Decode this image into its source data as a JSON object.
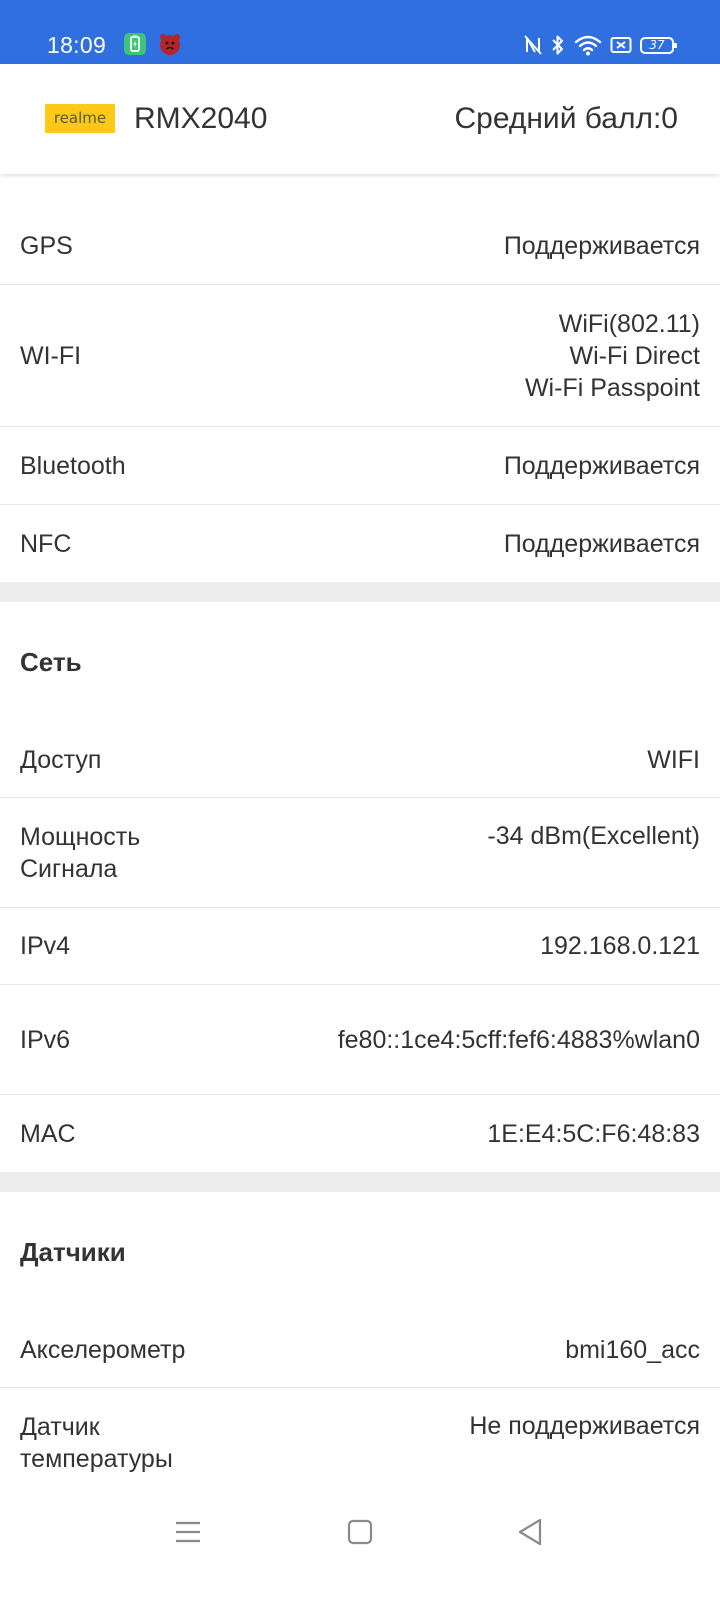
{
  "status_bar": {
    "time": "18:09",
    "battery_level": "37",
    "icons": [
      "battery-saver-icon",
      "app-notification-icon",
      "nfc-icon",
      "bluetooth-icon",
      "wifi-icon",
      "sim-icon",
      "battery-icon"
    ],
    "bg_color": "#2f6fe0"
  },
  "header": {
    "logo_text": "realme",
    "model": "RMX2040",
    "avg_score": "Средний балл:0",
    "logo_color": "#ffc915"
  },
  "connectivity": {
    "rows": [
      {
        "label": "GPS",
        "value": "Поддерживается"
      },
      {
        "label": "WI-FI",
        "values": [
          "WiFi(802.11)",
          "Wi-Fi Direct",
          "Wi-Fi Passpoint"
        ]
      },
      {
        "label": "Bluetooth",
        "value": "Поддерживается"
      },
      {
        "label": "NFC",
        "value": "Поддерживается"
      }
    ]
  },
  "network": {
    "title": "Сеть",
    "rows": [
      {
        "label": "Доступ",
        "value": "WIFI"
      },
      {
        "label": "Мощность Сигнала",
        "value": "-34 dBm(Excellent)"
      },
      {
        "label": "IPv4",
        "value": "192.168.0.121"
      },
      {
        "label": "IPv6",
        "value": "fe80::1ce4:5cff:fef6:4883%wlan0"
      },
      {
        "label": "MAC",
        "value": "1E:E4:5C:F6:48:83"
      }
    ]
  },
  "sensors": {
    "title": "Датчики",
    "rows": [
      {
        "label": "Акселерометр",
        "value": "bmi160_acc"
      },
      {
        "label": "Датчик температуры",
        "value": "Не поддерживается"
      }
    ]
  },
  "nav": {
    "icons": [
      "menu-icon",
      "home-icon",
      "back-icon"
    ]
  }
}
